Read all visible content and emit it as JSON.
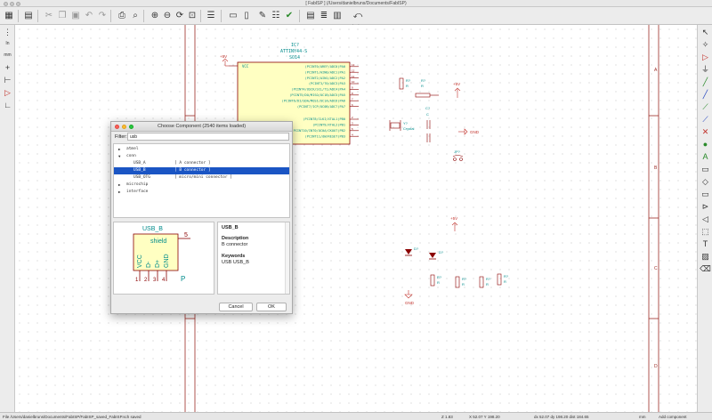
{
  "window": {
    "title": "[ FabISP ] (/Users/danielbruns/Documents/FabISP)"
  },
  "toolbar": {
    "buttons": [
      "new-sheet",
      "open",
      "save",
      "sep",
      "cut",
      "copy",
      "paste",
      "undo",
      "redo",
      "sep",
      "find",
      "replace",
      "sep",
      "zoom-in",
      "zoom-out",
      "zoom-redraw",
      "zoom-fit",
      "sep",
      "hierarchy",
      "library-editor",
      "library-browser",
      "sep",
      "netlist",
      "annotate",
      "erc",
      "sep",
      "cvpcb",
      "bom",
      "pcbnew",
      "back"
    ],
    "back_label": "back"
  },
  "schematic": {
    "ic": {
      "ref": "IC?",
      "value": "ATTINY44-S",
      "package": "SO14",
      "power_label": "VCC",
      "pins": [
        "(PCINT0/AREF/ADC0)PA0",
        "(PCINT1/AIN0/ADC1)PA1",
        "(PCINT2/AIN1/ADC2)PA2",
        "(PCINT3/T0/ADC3)PA3",
        "(PCINT4/USCK/SCL/T1/ADC4)PA4",
        "(PCINT5/DO/MISO/OC1B/ADC5)PA5",
        "(PCINT6/DI/SDA/MOSI/OC1A/ADC6)PA6",
        "(PCINT7/ICP/OC0B/ADC7)PA7",
        "(PCINT8/CLKI/XTAL1)PB0",
        "(PCINT9/XTAL2)PB1",
        "(PCINT10/INT0/OC0A/CKOUT)PB2",
        "(PCINT11/dW/RESET)PB3"
      ],
      "pin_numbers": [
        "13",
        "12",
        "11",
        "10",
        "9",
        "8",
        "7",
        "6",
        "2",
        "3",
        "5",
        "4"
      ]
    },
    "power": [
      "+5V",
      "+5V",
      "+5V"
    ],
    "gnd": [
      "GND",
      "GND"
    ],
    "resistors": [
      {
        "ref": "R?",
        "value": "R"
      },
      {
        "ref": "R?",
        "value": "R"
      },
      {
        "ref": "R?",
        "value": "R"
      },
      {
        "ref": "R?",
        "value": "R"
      },
      {
        "ref": "R?",
        "value": "R"
      },
      {
        "ref": "R?",
        "value": "R"
      }
    ],
    "crystal": {
      "ref": "Y?",
      "value": "Crystal"
    },
    "capacitor": {
      "ref": "C?",
      "value": "C"
    },
    "jumper": {
      "ref": "JP?"
    },
    "diodes": [
      {
        "ref": "D?"
      },
      {
        "ref": "D?"
      }
    ],
    "border_labels": [
      "A",
      "B",
      "C",
      "D"
    ]
  },
  "dialog": {
    "title": "Choose Component (2540 items loaded)",
    "filter_label": "Filter:",
    "filter_value": "usb",
    "tree": [
      {
        "name": "atmel",
        "desc": "",
        "level": 0,
        "arrow": "▶",
        "selected": false
      },
      {
        "name": "conn",
        "desc": "",
        "level": 0,
        "arrow": "▼",
        "selected": false
      },
      {
        "name": "USB_A",
        "desc": "[ A connector ]",
        "level": 1,
        "arrow": "",
        "selected": false
      },
      {
        "name": "USB_B",
        "desc": "[ B connector ]",
        "level": 1,
        "arrow": "",
        "selected": true
      },
      {
        "name": "USB_OTG",
        "desc": "[ micro/mini connector ]",
        "level": 1,
        "arrow": "",
        "selected": false
      },
      {
        "name": "microchip",
        "desc": "",
        "level": 0,
        "arrow": "▶",
        "selected": false
      },
      {
        "name": "interface",
        "desc": "",
        "level": 0,
        "arrow": "▶",
        "selected": false
      }
    ],
    "preview": {
      "name": "USB_B",
      "shield_label": "shield",
      "shield_pin": "5",
      "pin_labels": [
        "VCC",
        "D-",
        "D+",
        "GND"
      ],
      "pin_numbers": [
        "1",
        "2",
        "3",
        "4"
      ],
      "suffix": "P"
    },
    "info": {
      "name": "USB_B",
      "description_label": "Description",
      "description": "B connector",
      "keywords_label": "Keywords",
      "keywords": "USB USB_B"
    },
    "cancel_label": "Cancel",
    "ok_label": "OK"
  },
  "statusbar": {
    "file": "File /Users/danielbruns/Documents/FabISP/FabISP_saved_FabISP.sch saved",
    "zoom": "Z 1.83",
    "xy": "X 52.07  Y 198.20",
    "dxy": "dx 52.07  dy 198.20  dist 184.65",
    "units": "mm",
    "mode": "Add component"
  },
  "colors": {
    "wire": "#c0302a",
    "component_body": "#ffffc2",
    "component_line": "#8b0000",
    "pin_text": "#008b8b",
    "power": "#c0302a",
    "selection": "#1a55c4"
  }
}
